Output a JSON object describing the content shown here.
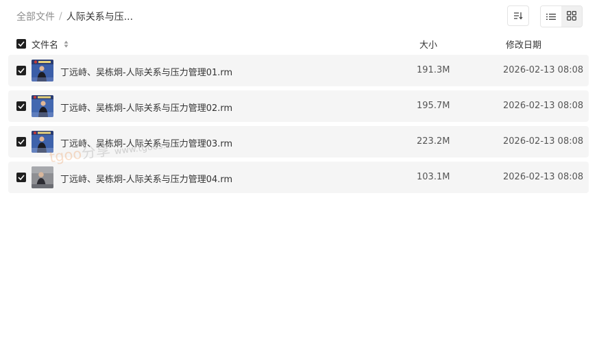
{
  "breadcrumb": {
    "root": "全部文件",
    "separator": "/",
    "current": "人际关系与压..."
  },
  "toolbar": {
    "sort_icon": "sort-icon",
    "list_view_icon": "list-view-icon",
    "grid_view_icon": "grid-view-icon",
    "active_view": "grid"
  },
  "header": {
    "name": "文件名",
    "size": "大小",
    "date": "修改日期"
  },
  "files": [
    {
      "name": "丁远峙、吴栋炯-人际关系与压力管理01.rm",
      "size": "191.3M",
      "date": "2026-02-13 08:08",
      "checked": true
    },
    {
      "name": "丁远峙、吴栋炯-人际关系与压力管理02.rm",
      "size": "195.7M",
      "date": "2026-02-13 08:08",
      "checked": true
    },
    {
      "name": "丁远峙、吴栋炯-人际关系与压力管理03.rm",
      "size": "223.2M",
      "date": "2026-02-13 08:08",
      "checked": true
    },
    {
      "name": "丁远峙、吴栋炯-人际关系与压力管理04.rm",
      "size": "103.1M",
      "date": "2026-02-13 08:08",
      "checked": true
    }
  ],
  "watermark": {
    "brand_latin": "tgoo",
    "brand_cn": "分享",
    "url": "www.tgoos.com"
  },
  "colors": {
    "row_bg": "#f5f5f5",
    "checkbox": "#1f1f1f",
    "muted_text": "#8c8c8c"
  }
}
